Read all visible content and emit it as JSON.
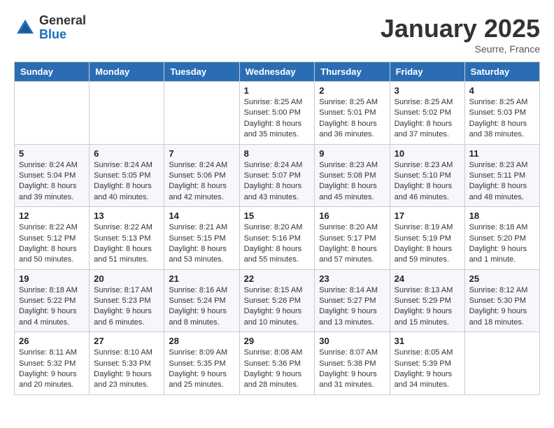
{
  "header": {
    "logo_general": "General",
    "logo_blue": "Blue",
    "month_title": "January 2025",
    "location": "Seurre, France"
  },
  "weekdays": [
    "Sunday",
    "Monday",
    "Tuesday",
    "Wednesday",
    "Thursday",
    "Friday",
    "Saturday"
  ],
  "weeks": [
    [
      {
        "day": "",
        "sunrise": "",
        "sunset": "",
        "daylight": ""
      },
      {
        "day": "",
        "sunrise": "",
        "sunset": "",
        "daylight": ""
      },
      {
        "day": "",
        "sunrise": "",
        "sunset": "",
        "daylight": ""
      },
      {
        "day": "1",
        "sunrise": "Sunrise: 8:25 AM",
        "sunset": "Sunset: 5:00 PM",
        "daylight": "Daylight: 8 hours and 35 minutes."
      },
      {
        "day": "2",
        "sunrise": "Sunrise: 8:25 AM",
        "sunset": "Sunset: 5:01 PM",
        "daylight": "Daylight: 8 hours and 36 minutes."
      },
      {
        "day": "3",
        "sunrise": "Sunrise: 8:25 AM",
        "sunset": "Sunset: 5:02 PM",
        "daylight": "Daylight: 8 hours and 37 minutes."
      },
      {
        "day": "4",
        "sunrise": "Sunrise: 8:25 AM",
        "sunset": "Sunset: 5:03 PM",
        "daylight": "Daylight: 8 hours and 38 minutes."
      }
    ],
    [
      {
        "day": "5",
        "sunrise": "Sunrise: 8:24 AM",
        "sunset": "Sunset: 5:04 PM",
        "daylight": "Daylight: 8 hours and 39 minutes."
      },
      {
        "day": "6",
        "sunrise": "Sunrise: 8:24 AM",
        "sunset": "Sunset: 5:05 PM",
        "daylight": "Daylight: 8 hours and 40 minutes."
      },
      {
        "day": "7",
        "sunrise": "Sunrise: 8:24 AM",
        "sunset": "Sunset: 5:06 PM",
        "daylight": "Daylight: 8 hours and 42 minutes."
      },
      {
        "day": "8",
        "sunrise": "Sunrise: 8:24 AM",
        "sunset": "Sunset: 5:07 PM",
        "daylight": "Daylight: 8 hours and 43 minutes."
      },
      {
        "day": "9",
        "sunrise": "Sunrise: 8:23 AM",
        "sunset": "Sunset: 5:08 PM",
        "daylight": "Daylight: 8 hours and 45 minutes."
      },
      {
        "day": "10",
        "sunrise": "Sunrise: 8:23 AM",
        "sunset": "Sunset: 5:10 PM",
        "daylight": "Daylight: 8 hours and 46 minutes."
      },
      {
        "day": "11",
        "sunrise": "Sunrise: 8:23 AM",
        "sunset": "Sunset: 5:11 PM",
        "daylight": "Daylight: 8 hours and 48 minutes."
      }
    ],
    [
      {
        "day": "12",
        "sunrise": "Sunrise: 8:22 AM",
        "sunset": "Sunset: 5:12 PM",
        "daylight": "Daylight: 8 hours and 50 minutes."
      },
      {
        "day": "13",
        "sunrise": "Sunrise: 8:22 AM",
        "sunset": "Sunset: 5:13 PM",
        "daylight": "Daylight: 8 hours and 51 minutes."
      },
      {
        "day": "14",
        "sunrise": "Sunrise: 8:21 AM",
        "sunset": "Sunset: 5:15 PM",
        "daylight": "Daylight: 8 hours and 53 minutes."
      },
      {
        "day": "15",
        "sunrise": "Sunrise: 8:20 AM",
        "sunset": "Sunset: 5:16 PM",
        "daylight": "Daylight: 8 hours and 55 minutes."
      },
      {
        "day": "16",
        "sunrise": "Sunrise: 8:20 AM",
        "sunset": "Sunset: 5:17 PM",
        "daylight": "Daylight: 8 hours and 57 minutes."
      },
      {
        "day": "17",
        "sunrise": "Sunrise: 8:19 AM",
        "sunset": "Sunset: 5:19 PM",
        "daylight": "Daylight: 8 hours and 59 minutes."
      },
      {
        "day": "18",
        "sunrise": "Sunrise: 8:18 AM",
        "sunset": "Sunset: 5:20 PM",
        "daylight": "Daylight: 9 hours and 1 minute."
      }
    ],
    [
      {
        "day": "19",
        "sunrise": "Sunrise: 8:18 AM",
        "sunset": "Sunset: 5:22 PM",
        "daylight": "Daylight: 9 hours and 4 minutes."
      },
      {
        "day": "20",
        "sunrise": "Sunrise: 8:17 AM",
        "sunset": "Sunset: 5:23 PM",
        "daylight": "Daylight: 9 hours and 6 minutes."
      },
      {
        "day": "21",
        "sunrise": "Sunrise: 8:16 AM",
        "sunset": "Sunset: 5:24 PM",
        "daylight": "Daylight: 9 hours and 8 minutes."
      },
      {
        "day": "22",
        "sunrise": "Sunrise: 8:15 AM",
        "sunset": "Sunset: 5:26 PM",
        "daylight": "Daylight: 9 hours and 10 minutes."
      },
      {
        "day": "23",
        "sunrise": "Sunrise: 8:14 AM",
        "sunset": "Sunset: 5:27 PM",
        "daylight": "Daylight: 9 hours and 13 minutes."
      },
      {
        "day": "24",
        "sunrise": "Sunrise: 8:13 AM",
        "sunset": "Sunset: 5:29 PM",
        "daylight": "Daylight: 9 hours and 15 minutes."
      },
      {
        "day": "25",
        "sunrise": "Sunrise: 8:12 AM",
        "sunset": "Sunset: 5:30 PM",
        "daylight": "Daylight: 9 hours and 18 minutes."
      }
    ],
    [
      {
        "day": "26",
        "sunrise": "Sunrise: 8:11 AM",
        "sunset": "Sunset: 5:32 PM",
        "daylight": "Daylight: 9 hours and 20 minutes."
      },
      {
        "day": "27",
        "sunrise": "Sunrise: 8:10 AM",
        "sunset": "Sunset: 5:33 PM",
        "daylight": "Daylight: 9 hours and 23 minutes."
      },
      {
        "day": "28",
        "sunrise": "Sunrise: 8:09 AM",
        "sunset": "Sunset: 5:35 PM",
        "daylight": "Daylight: 9 hours and 25 minutes."
      },
      {
        "day": "29",
        "sunrise": "Sunrise: 8:08 AM",
        "sunset": "Sunset: 5:36 PM",
        "daylight": "Daylight: 9 hours and 28 minutes."
      },
      {
        "day": "30",
        "sunrise": "Sunrise: 8:07 AM",
        "sunset": "Sunset: 5:38 PM",
        "daylight": "Daylight: 9 hours and 31 minutes."
      },
      {
        "day": "31",
        "sunrise": "Sunrise: 8:05 AM",
        "sunset": "Sunset: 5:39 PM",
        "daylight": "Daylight: 9 hours and 34 minutes."
      },
      {
        "day": "",
        "sunrise": "",
        "sunset": "",
        "daylight": ""
      }
    ]
  ]
}
